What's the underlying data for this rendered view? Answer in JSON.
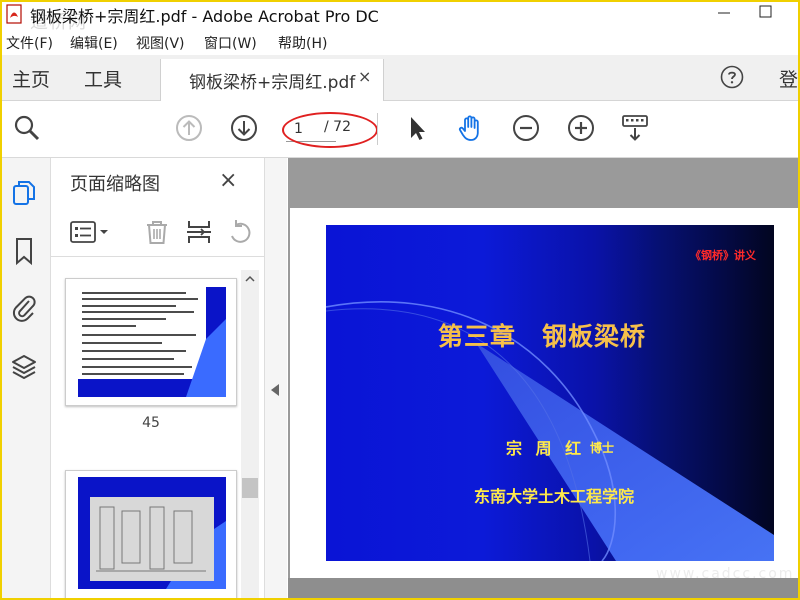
{
  "window": {
    "title": "钢板梁桥+宗周红.pdf - Adobe Acrobat Pro DC",
    "watermark": "道桥网"
  },
  "menu": [
    "文件(F)",
    "编辑(E)",
    "视图(V)",
    "窗口(W)",
    "帮助(H)"
  ],
  "tabs": {
    "home": "主页",
    "tools": "工具",
    "document": "钢板梁桥+宗周红.pdf",
    "close": "×",
    "signin": "登"
  },
  "toolbar": {
    "current_page": "1",
    "total_pages": "/ 72"
  },
  "thumbnails": {
    "title": "页面缩略图",
    "close": "×",
    "pages": [
      "45"
    ]
  },
  "slide": {
    "tag": "《钢桥》讲义",
    "title": "第三章　钢板梁桥",
    "author": "宗 周 红",
    "degree": "博士",
    "school": "东南大学土木工程学院"
  },
  "watermark_bottom": "www.cadcc.com",
  "colors": {
    "accent": "#1473e6",
    "slide_title": "#f6c04a",
    "slide_text": "#ffe94a",
    "annotation": "#e02020"
  }
}
